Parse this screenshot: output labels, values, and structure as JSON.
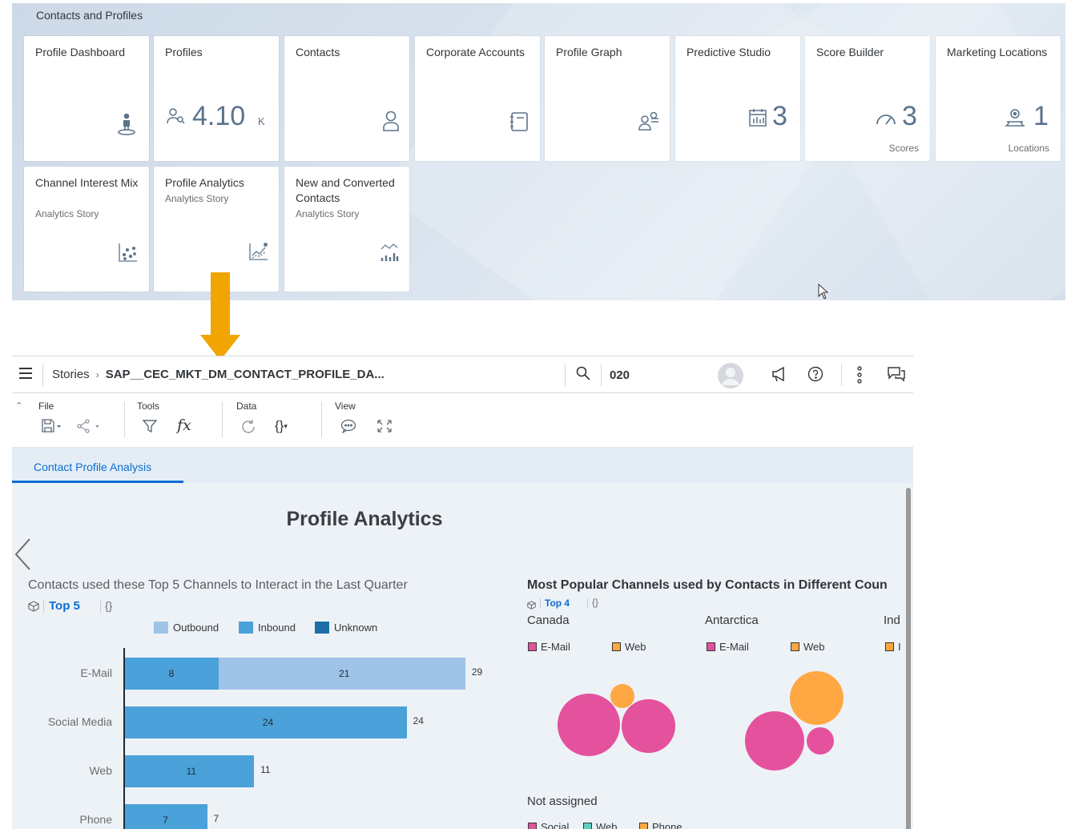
{
  "launchpad": {
    "group_title": "Contacts and Profiles",
    "tiles": [
      {
        "title": "Profile Dashboard",
        "icon": "person-pin-icon"
      },
      {
        "title": "Profiles",
        "icon": "person-search-icon",
        "number": "4.10",
        "unit": "K"
      },
      {
        "title": "Contacts",
        "icon": "person-icon"
      },
      {
        "title": "Corporate Accounts",
        "icon": "address-book-icon"
      },
      {
        "title": "Profile Graph",
        "icon": "group-icon"
      },
      {
        "title": "Predictive Studio",
        "icon": "calendar-chart-icon",
        "number": "3"
      },
      {
        "title": "Score Builder",
        "icon": "gauge-icon",
        "number": "3",
        "footer": "Scores"
      },
      {
        "title": "Marketing Locations",
        "icon": "location-icon",
        "number": "1",
        "footer": "Locations"
      },
      {
        "title": "Channel Interest Mix",
        "subtitle": "Analytics Story",
        "icon": "scatter-chart-icon"
      },
      {
        "title": "Profile Analytics",
        "subtitle": "Analytics Story",
        "icon": "line-chart-icon"
      },
      {
        "title": "New and Converted Contacts",
        "subtitle": "Analytics Story",
        "icon": "bar-line-chart-icon"
      }
    ]
  },
  "shell": {
    "breadcrumb_root": "Stories",
    "breadcrumb_current": "SAP__CEC_MKT_DM_CONTACT_PROFILE_DA...",
    "search_value": "020"
  },
  "toolbar": {
    "file_label": "File",
    "tools_label": "Tools",
    "data_label": "Data",
    "view_label": "View"
  },
  "tabs": [
    {
      "label": "Contact Profile Analysis"
    }
  ],
  "story": {
    "page_title": "Profile Analytics",
    "left_widget": {
      "title": "Contacts used these Top 5 Channels to Interact in the Last Quarter",
      "topn": "Top 5",
      "curly": "{}",
      "legend": [
        "Outbound",
        "Inbound",
        "Unknown"
      ]
    },
    "right_widget": {
      "title": "Most Popular Channels used by Contacts in Different Coun",
      "topn": "Top 4",
      "curly": "{}",
      "countries": [
        "Canada",
        "Antarctica",
        "Ind",
        "Not assigned"
      ],
      "legend_canada": [
        "E-Mail",
        "Web"
      ],
      "legend_antarctica": [
        "E-Mail",
        "Web"
      ],
      "legend_ind": [
        "I"
      ],
      "legend_not_assigned": [
        "Social",
        "Web",
        "Phone"
      ]
    }
  },
  "colors": {
    "outbound": "#9fc3e7",
    "inbound": "#4ba1d9",
    "unknown": "#1c6ea8",
    "email": "#e4519d",
    "web": "#ffa742",
    "social": "#e4519d",
    "web_teal": "#5ecfc2",
    "phone": "#ffa742",
    "arrow": "#f0a500"
  },
  "chart_data": [
    {
      "type": "bar",
      "orientation": "horizontal",
      "categories": [
        "E-Mail",
        "Social Media",
        "Web",
        "Phone"
      ],
      "series": [
        {
          "name": "Inbound",
          "values": [
            8,
            24,
            11,
            7
          ]
        },
        {
          "name": "Outbound",
          "values": [
            21,
            0,
            0,
            0
          ]
        }
      ],
      "totals": [
        29,
        24,
        11,
        7
      ]
    },
    {
      "type": "bubble",
      "groups": [
        {
          "country": "Canada",
          "bubbles": [
            {
              "channel": "E-Mail",
              "value": 10
            },
            {
              "channel": "E-Mail",
              "value": 7.3
            },
            {
              "channel": "Web",
              "value": 1.5
            }
          ]
        },
        {
          "country": "Antarctica",
          "bubbles": [
            {
              "channel": "E-Mail",
              "value": 9
            },
            {
              "channel": "Web",
              "value": 7.3
            },
            {
              "channel": "E-Mail",
              "value": 1.9
            }
          ]
        }
      ]
    }
  ]
}
